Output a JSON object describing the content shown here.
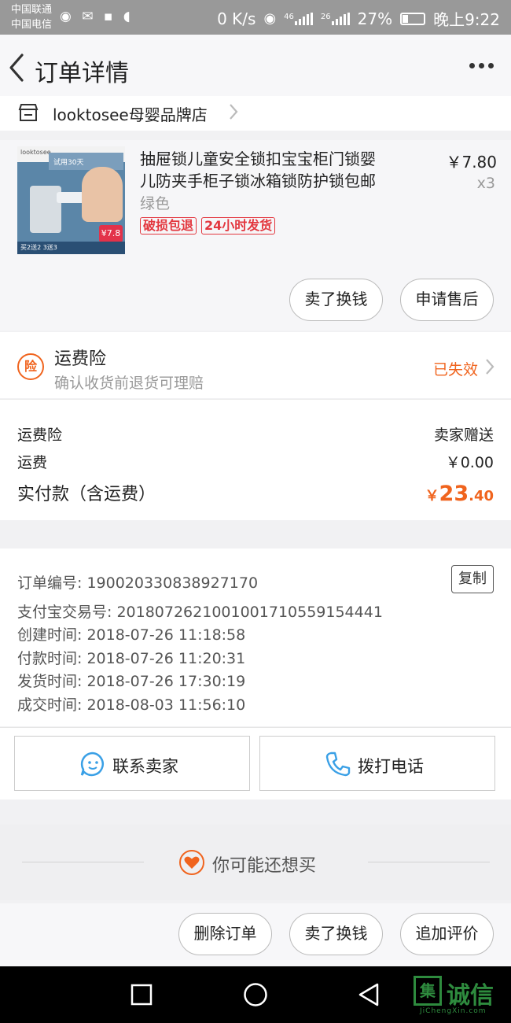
{
  "status_bar": {
    "carrier1": "中国联通",
    "carrier2": "中国电信",
    "net_speed": "0 K/s",
    "net1": "46",
    "net2": "26",
    "battery": "27%",
    "battery_level": 0.27,
    "time": "晚上9:22"
  },
  "navbar": {
    "title": "订单详情"
  },
  "shop": {
    "name": "looktosee母婴品牌店"
  },
  "product": {
    "title_line1": "抽屉锁儿童安全锁扣宝宝柜门锁婴",
    "title_line2": "儿防夹手柜子锁冰箱锁防护锁包邮",
    "variant": "绿色",
    "tags": [
      "破损包退",
      "24小时发货"
    ],
    "price": "￥7.80",
    "quantity": "x3",
    "thumb": {
      "brand": "looktosee",
      "banner": "试用30天",
      "price_badge": "¥7.8",
      "bottom": "买2送2 3送3"
    },
    "buttons": {
      "sell": "卖了换钱",
      "after_sale": "申请售后"
    }
  },
  "insurance": {
    "icon_label": "险",
    "title": "运费险",
    "desc": "确认收货前退货可理赔",
    "status": "已失效"
  },
  "fees": {
    "rows": [
      {
        "label": "运费险",
        "value": "卖家赠送"
      },
      {
        "label": "运费",
        "value": "￥0.00"
      }
    ],
    "total_label": "实付款（含运费）",
    "total_symbol": "￥",
    "total_int": "23",
    "total_dec": ".40"
  },
  "order_info": {
    "copy_label": "复制",
    "rows": [
      "订单编号: 190020330838927170",
      "支付宝交易号: 2018072621001001710559154441",
      "创建时间: 2018-07-26 11:18:58",
      "付款时间: 2018-07-26 11:20:31",
      "发货时间: 2018-07-26 17:30:19",
      "成交时间: 2018-08-03 11:56:10"
    ]
  },
  "contact": {
    "seller": "联系卖家",
    "call": "拨打电话"
  },
  "recommend": {
    "label": "你可能还想买"
  },
  "actions": {
    "delete": "删除订单",
    "sell": "卖了换钱",
    "review": "追加评价"
  },
  "watermark": {
    "box": "集",
    "text": "诚信",
    "sub": "JiChengXin.com"
  },
  "colors": {
    "accent": "#f0641e",
    "tag_red": "#e3373f",
    "status_bar": "#999999"
  }
}
